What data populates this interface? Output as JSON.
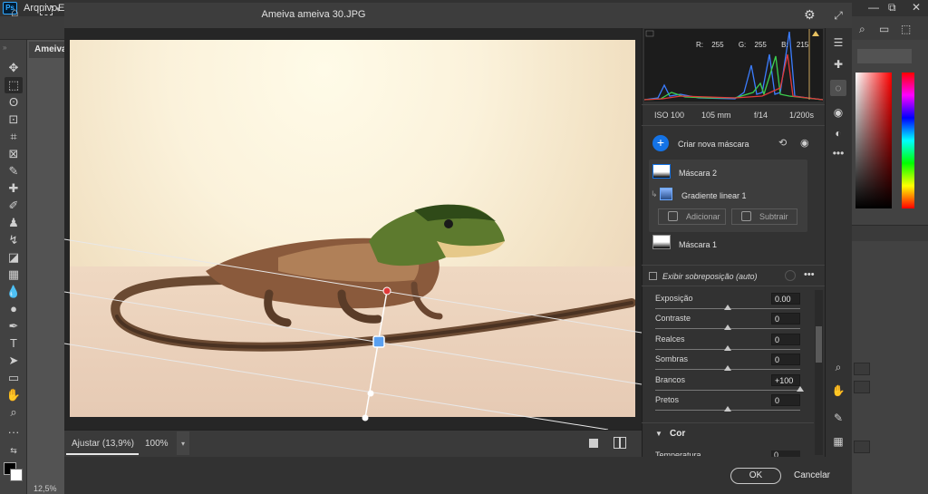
{
  "photoshop": {
    "logo": "Ps",
    "menu": [
      "Arquivo",
      "E"
    ],
    "doc_tab": "Ameiva a",
    "zoom_status": "12,5%",
    "window_controls": [
      "—",
      "⧉",
      "✕"
    ]
  },
  "dialog": {
    "title": "Ameiva ameiva 30.JPG",
    "histogram": {
      "r_label": "R:",
      "r": "255",
      "g_label": "G:",
      "g": "255",
      "b_label": "B:",
      "b": "215"
    },
    "exif": {
      "iso": "ISO 100",
      "focal": "105 mm",
      "aperture": "f/14",
      "shutter": "1/200s"
    },
    "masks": {
      "create_new": "Criar nova máscara",
      "items": [
        {
          "name": "Máscara 2",
          "sub": "Gradiente linear 1",
          "selected": true
        },
        {
          "name": "Máscara 1"
        }
      ],
      "add_label": "Adicionar",
      "subtract_label": "Subtrair",
      "overlay_label": "Exibir sobreposição (auto)"
    },
    "sliders": [
      {
        "label": "Exposição",
        "value": "0.00",
        "pos": 0.5
      },
      {
        "label": "Contraste",
        "value": "0",
        "pos": 0.5
      },
      {
        "label": "Realces",
        "value": "0",
        "pos": 0.5
      },
      {
        "label": "Sombras",
        "value": "0",
        "pos": 0.5
      },
      {
        "label": "Brancos",
        "value": "+100",
        "pos": 1.0
      },
      {
        "label": "Pretos",
        "value": "0",
        "pos": 0.5
      }
    ],
    "color_section": {
      "title": "Cor",
      "first_slider": "Temperatura",
      "first_value": "0"
    },
    "bottom": {
      "fit": "Ajustar (13,9%)",
      "zoom": "100%"
    },
    "ok_label": "OK",
    "cancel_label": "Cancelar"
  }
}
